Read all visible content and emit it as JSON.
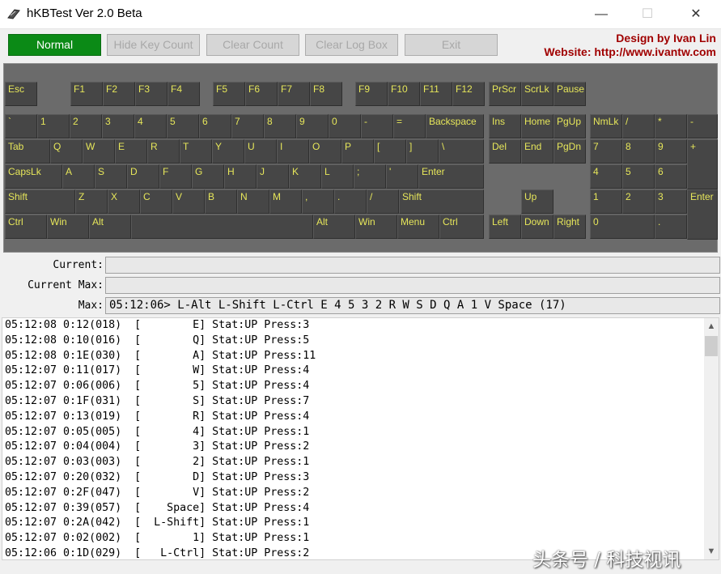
{
  "window": {
    "title": "hKBTest Ver 2.0 Beta",
    "minimize": "—",
    "maximize": "☐",
    "close": "✕"
  },
  "toolbar": {
    "normal": "Normal",
    "hide_key_count": "Hide Key Count",
    "clear_count": "Clear Count",
    "clear_log_box": "Clear Log Box",
    "exit": "Exit",
    "credit_line1": "Design by Ivan Lin",
    "credit_line2": "Website: http://www.ivantw.com"
  },
  "keys": [
    "Esc",
    "F1",
    "F2",
    "F3",
    "F4",
    "F5",
    "F6",
    "F7",
    "F8",
    "F9",
    "F10",
    "F11",
    "F12",
    "PrScr",
    "ScrLk",
    "Pause",
    "`",
    "1",
    "2",
    "3",
    "4",
    "5",
    "6",
    "7",
    "8",
    "9",
    "0",
    "-",
    "=",
    "Backspace",
    "Ins",
    "Home",
    "PgUp",
    "NmLk",
    "/",
    "*",
    "-",
    "Tab",
    "Q",
    "W",
    "E",
    "R",
    "T",
    "Y",
    "U",
    "I",
    "O",
    "P",
    "[",
    "]",
    "\\",
    "Del",
    "End",
    "PgDn",
    "7",
    "8",
    "9",
    "+",
    "CapsLk",
    "A",
    "S",
    "D",
    "F",
    "G",
    "H",
    "J",
    "K",
    "L",
    ";",
    "'",
    "Enter",
    "4",
    "5",
    "6",
    "Shift",
    "Z",
    "X",
    "C",
    "V",
    "B",
    "N",
    "M",
    ",",
    ".",
    "/",
    "Shift",
    "Up",
    "1",
    "2",
    "3",
    "Enter",
    "Ctrl",
    "Win",
    "Alt",
    "",
    "Alt",
    "Win",
    "Menu",
    "Ctrl",
    "Left",
    "Down",
    "Right",
    "0",
    "."
  ],
  "counters": {
    "current_label": "Current:",
    "current_value": "",
    "current_max_label": "Current Max:",
    "current_max_value": "",
    "max_label": "Max:",
    "max_value": "05:12:06> L-Alt L-Shift L-Ctrl E 4 5 3 2 R W S D Q A 1 V Space (17)"
  },
  "log": [
    "05:12:08 0:12(018)  [        E] Stat:UP Press:3",
    "05:12:08 0:10(016)  [        Q] Stat:UP Press:5",
    "05:12:08 0:1E(030)  [        A] Stat:UP Press:11",
    "05:12:07 0:11(017)  [        W] Stat:UP Press:4",
    "05:12:07 0:06(006)  [        5] Stat:UP Press:4",
    "05:12:07 0:1F(031)  [        S] Stat:UP Press:7",
    "05:12:07 0:13(019)  [        R] Stat:UP Press:4",
    "05:12:07 0:05(005)  [        4] Stat:UP Press:1",
    "05:12:07 0:04(004)  [        3] Stat:UP Press:2",
    "05:12:07 0:03(003)  [        2] Stat:UP Press:1",
    "05:12:07 0:20(032)  [        D] Stat:UP Press:3",
    "05:12:07 0:2F(047)  [        V] Stat:UP Press:2",
    "05:12:07 0:39(057)  [    Space] Stat:UP Press:4",
    "05:12:07 0:2A(042)  [  L-Shift] Stat:UP Press:1",
    "05:12:07 0:02(002)  [        1] Stat:UP Press:1",
    "05:12:06 0:1D(029)  [   L-Ctrl] Stat:UP Press:2"
  ],
  "watermark": "头条号 / 科技视讯",
  "colors": {
    "normal_button": "#0b8a16",
    "key_text": "#e6e65a",
    "key_bg": "#464646",
    "panel_bg": "#6b6b6b",
    "credit": "#a00000"
  }
}
